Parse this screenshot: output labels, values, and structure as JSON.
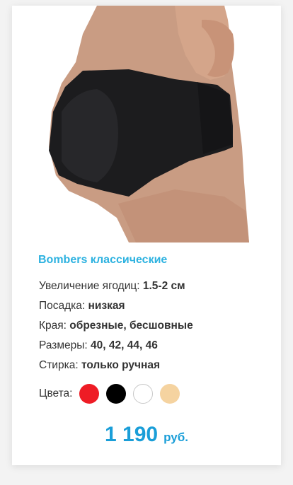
{
  "product": {
    "title": "Bombers классические",
    "image_alt": "product-photo",
    "specs": [
      {
        "label": "Увеличение ягодиц:",
        "value": "1.5-2 см"
      },
      {
        "label": "Посадка:",
        "value": "низкая"
      },
      {
        "label": "Края:",
        "value": "обрезные, бесшовные"
      },
      {
        "label": "Размеры:",
        "value": "40, 42, 44, 46"
      },
      {
        "label": "Стирка:",
        "value": "только ручная"
      }
    ],
    "colors_label": "Цвета:",
    "colors": [
      {
        "name": "red",
        "hex": "#ee1c25"
      },
      {
        "name": "black",
        "hex": "#000000"
      },
      {
        "name": "white",
        "hex": "#ffffff"
      },
      {
        "name": "beige",
        "hex": "#f5d3a0"
      }
    ],
    "price": {
      "amount": "1 190",
      "currency": "руб."
    }
  }
}
